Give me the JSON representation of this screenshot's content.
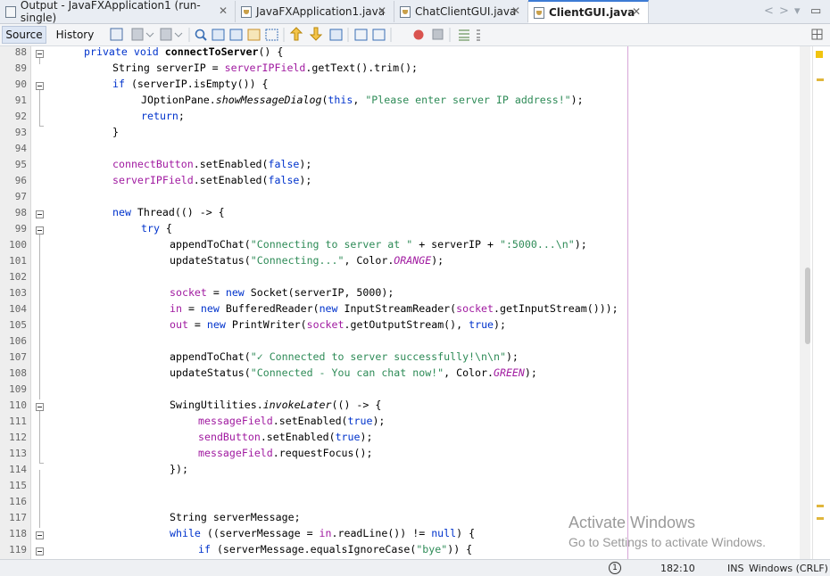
{
  "tabs": [
    {
      "label": "Output - JavaFXApplication1 (run-single)",
      "icon": "output-icon",
      "active": false
    },
    {
      "label": "JavaFXApplication1.java",
      "icon": "java-file-icon",
      "active": false
    },
    {
      "label": "ChatClientGUI.java",
      "icon": "java-file-icon",
      "active": false
    },
    {
      "label": "ClientGUI.java",
      "icon": "java-file-icon",
      "active": true
    }
  ],
  "tab_close_glyph": "✕",
  "tab_nav": {
    "left": "<",
    "right": ">",
    "down": "▾",
    "maximize": "▭"
  },
  "toolbar": {
    "source_label": "Source",
    "history_label": "History"
  },
  "line_numbers": [
    "88",
    "89",
    "90",
    "91",
    "92",
    "93",
    "94",
    "95",
    "96",
    "97",
    "98",
    "99",
    "100",
    "101",
    "102",
    "103",
    "104",
    "105",
    "106",
    "107",
    "108",
    "109",
    "110",
    "111",
    "112",
    "113",
    "114",
    "115",
    "116",
    "117",
    "118",
    "119"
  ],
  "status": {
    "notifications": "1",
    "position": "182:10",
    "mode": "INS",
    "line_ending": "Windows (CRLF)"
  },
  "watermark": {
    "title": "Activate Windows",
    "subtitle": "Go to Settings to activate Windows."
  },
  "colors": {
    "keyword": "#0033cc",
    "field": "#a01aa0",
    "string": "#2e8b57",
    "margin_line": "#d7a6d8",
    "active_tab_accent": "#3d7bd4"
  }
}
